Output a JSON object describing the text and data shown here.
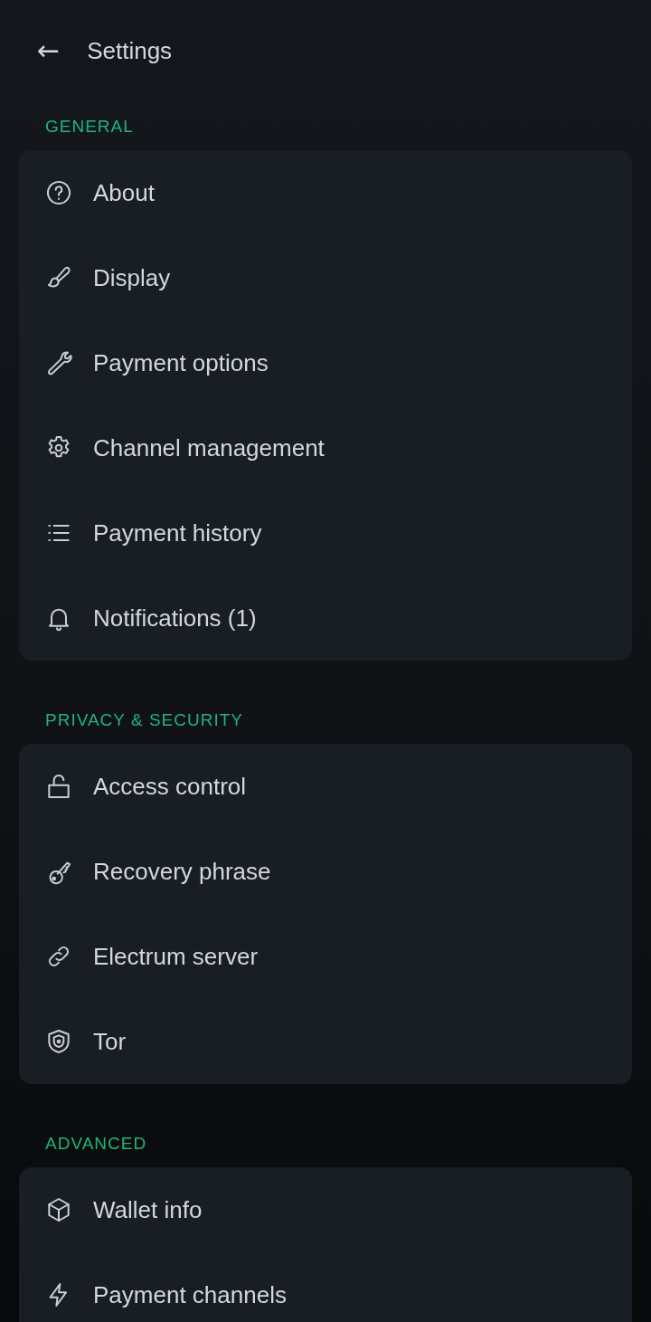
{
  "header": {
    "back_icon": "←",
    "title": "Settings"
  },
  "sections": [
    {
      "title": "GENERAL",
      "items": [
        {
          "label": "About",
          "kind": "help"
        },
        {
          "label": "Display",
          "kind": "brush"
        },
        {
          "label": "Payment options",
          "kind": "wrench"
        },
        {
          "label": "Channel management",
          "kind": "gear"
        },
        {
          "label": "Payment history",
          "kind": "list"
        },
        {
          "label": "Notifications (1)",
          "kind": "bell"
        }
      ]
    },
    {
      "title": "PRIVACY & SECURITY",
      "items": [
        {
          "label": "Access control",
          "kind": "lock"
        },
        {
          "label": "Recovery phrase",
          "kind": "key"
        },
        {
          "label": "Electrum server",
          "kind": "link"
        },
        {
          "label": "Tor",
          "kind": "shield"
        }
      ]
    },
    {
      "title": "ADVANCED",
      "items": [
        {
          "label": "Wallet info",
          "kind": "cube"
        },
        {
          "label": "Payment channels",
          "kind": "bolt"
        }
      ]
    }
  ]
}
